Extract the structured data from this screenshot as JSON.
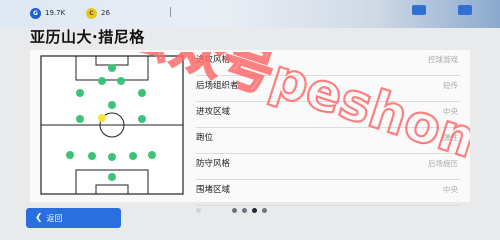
{
  "currency": {
    "gp": {
      "icon": "gp-coin-icon",
      "label": "G",
      "value": "19.7K"
    },
    "coins": {
      "icon": "gold-coin-icon",
      "label": "C",
      "value": "26"
    }
  },
  "page": {
    "title": "亚历山大·措尼格"
  },
  "attributes": [
    {
      "label": "进攻风格",
      "value": "控球游戏"
    },
    {
      "label": "后场组织者",
      "value": "短传"
    },
    {
      "label": "进攻区域",
      "value": "中央"
    },
    {
      "label": "跑位",
      "value": "弹性"
    },
    {
      "label": "防守风格",
      "value": "后场施压"
    },
    {
      "label": "围堵区域",
      "value": "中央"
    }
  ],
  "pagination": {
    "total": 5,
    "active_index": 3
  },
  "back_button": {
    "label": "返回",
    "icon": "chevron-left-icon"
  },
  "watermark": {
    "text": "公众号peshome",
    "color": "#ff6a6a"
  },
  "colors": {
    "accent": "#2a6fe0",
    "player_dot": "#3cc37a",
    "player_dot_highlight": "#f2e63a"
  }
}
